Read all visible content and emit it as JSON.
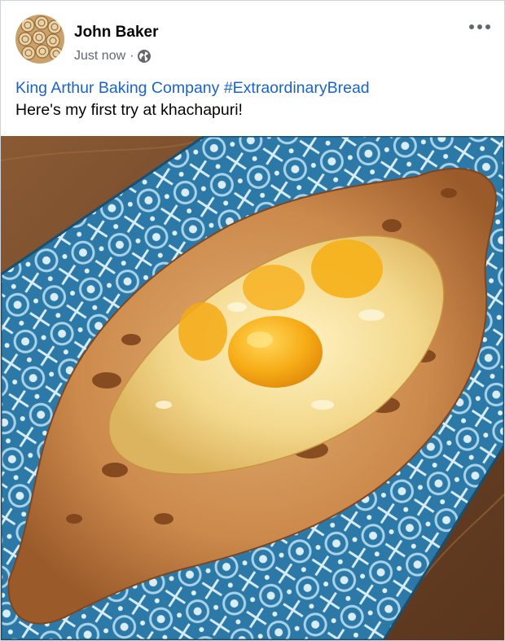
{
  "post": {
    "author": "John Baker",
    "timestamp": "Just now",
    "separator": "·",
    "privacy_icon": "globe-icon",
    "more_icon": "more-options-icon",
    "page_tag": "King Arthur Baking Company",
    "hashtag": "#ExtraordinaryBread",
    "text": "Here's my first try at khachapuri!"
  },
  "colors": {
    "link": "#1a64c8",
    "meta": "#65676b",
    "name": "#050505",
    "tile_blue": "#2c78a6",
    "wood": "#7a4e2e"
  }
}
